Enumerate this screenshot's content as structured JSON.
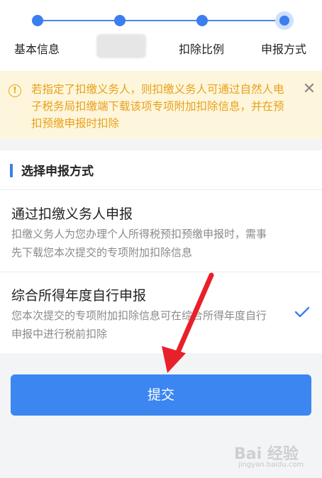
{
  "stepper": {
    "steps": [
      {
        "label": "基本信息",
        "state": "done"
      },
      {
        "label": "",
        "state": "done"
      },
      {
        "label": "扣除比例",
        "state": "done"
      },
      {
        "label": "申报方式",
        "state": "current"
      }
    ],
    "accent_color": "#3b7ef0"
  },
  "notice": {
    "icon": "warning-icon",
    "text": "若指定了扣缴义务人，则扣缴义务人可通过自然人电子税务局扣缴端下载该项专项附加扣除信息，并在预扣预缴申报时扣除",
    "close_icon": "close-icon",
    "text_color": "#e8a01a"
  },
  "section": {
    "title": "选择申报方式",
    "options": [
      {
        "title": "通过扣缴义务人申报",
        "description": "扣缴义务人为您办理个人所得税预扣预缴申报时，需事先下载您本次提交的专项附加扣除信息",
        "selected": false
      },
      {
        "title": "综合所得年度自行申报",
        "description": "您本次提交的专项附加扣除信息可在综合所得年度自行申报中进行税前扣除",
        "selected": true
      }
    ]
  },
  "submit": {
    "label": "提交",
    "color": "#3b86f0"
  },
  "watermark": {
    "text": "Bai 经验",
    "subtext": "jingyan.baidu.com"
  }
}
